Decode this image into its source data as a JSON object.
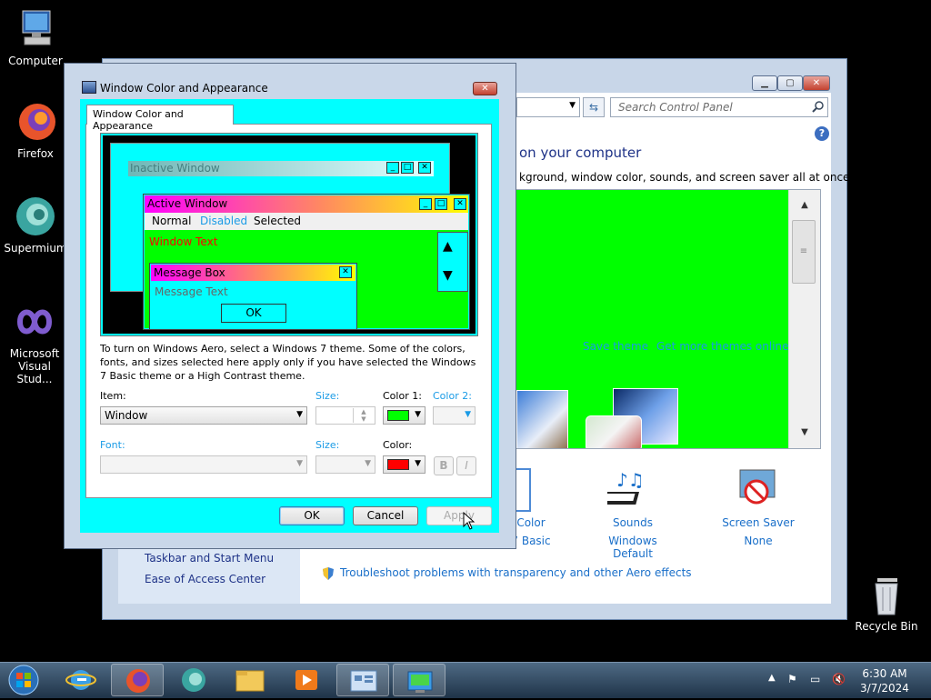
{
  "desktop": {
    "icons": [
      {
        "label": "Computer"
      },
      {
        "label": "Firefox"
      },
      {
        "label": "Supermium"
      },
      {
        "label": "Microsoft Visual Stud..."
      },
      {
        "label": "Recycle Bin"
      }
    ]
  },
  "control_panel": {
    "search_placeholder": "Search Control Panel",
    "heading": "on your computer",
    "subheading": "kground, window color, sounds, and screen saver all at once.",
    "theme_links": {
      "save": "Save theme",
      "more": "Get more themes online"
    },
    "bottom_items": [
      {
        "title": "Color",
        "subtitle": "7 Basic"
      },
      {
        "title": "Sounds",
        "subtitle": "Windows Default"
      },
      {
        "title": "Screen Saver",
        "subtitle": "None"
      }
    ],
    "left_links": [
      "Taskbar and Start Menu",
      "Ease of Access Center"
    ],
    "troubleshoot_link": "Troubleshoot problems with transparency and other Aero effects",
    "help": "?",
    "win_min": "▁",
    "win_max": "▢",
    "win_close": "✕"
  },
  "dialog": {
    "title": "Window Color and Appearance",
    "tab_label": "Window Color and Appearance",
    "close_glyph": "✕",
    "preview": {
      "inactive_title": "Inactive Window",
      "active_title": "Active Window",
      "menu": [
        "Normal",
        "Disabled",
        "Selected"
      ],
      "window_text": "Window Text",
      "message_box_title": "Message Box",
      "message_text": "Message Text",
      "ok": "OK"
    },
    "info_text": "To turn on Windows Aero, select a Windows 7 theme.  Some of the colors, fonts, and sizes selected here apply only if you have selected the Windows 7 Basic theme or a High Contrast theme.",
    "item_label": "Item:",
    "item_value": "Window",
    "size_label": "Size:",
    "size_value": "",
    "color1_label": "Color 1:",
    "color1": "#00ff00",
    "color2_label": "Color 2:",
    "font_label": "Font:",
    "font_value": "",
    "font_size_label": "Size:",
    "font_color_label": "Color:",
    "font_color": "#ff0000",
    "bold": "B",
    "italic": "I",
    "buttons": {
      "ok": "OK",
      "cancel": "Cancel",
      "apply": "Apply"
    }
  },
  "taskbar": {
    "clock_time": "6:30 AM",
    "clock_date": "3/7/2024"
  }
}
